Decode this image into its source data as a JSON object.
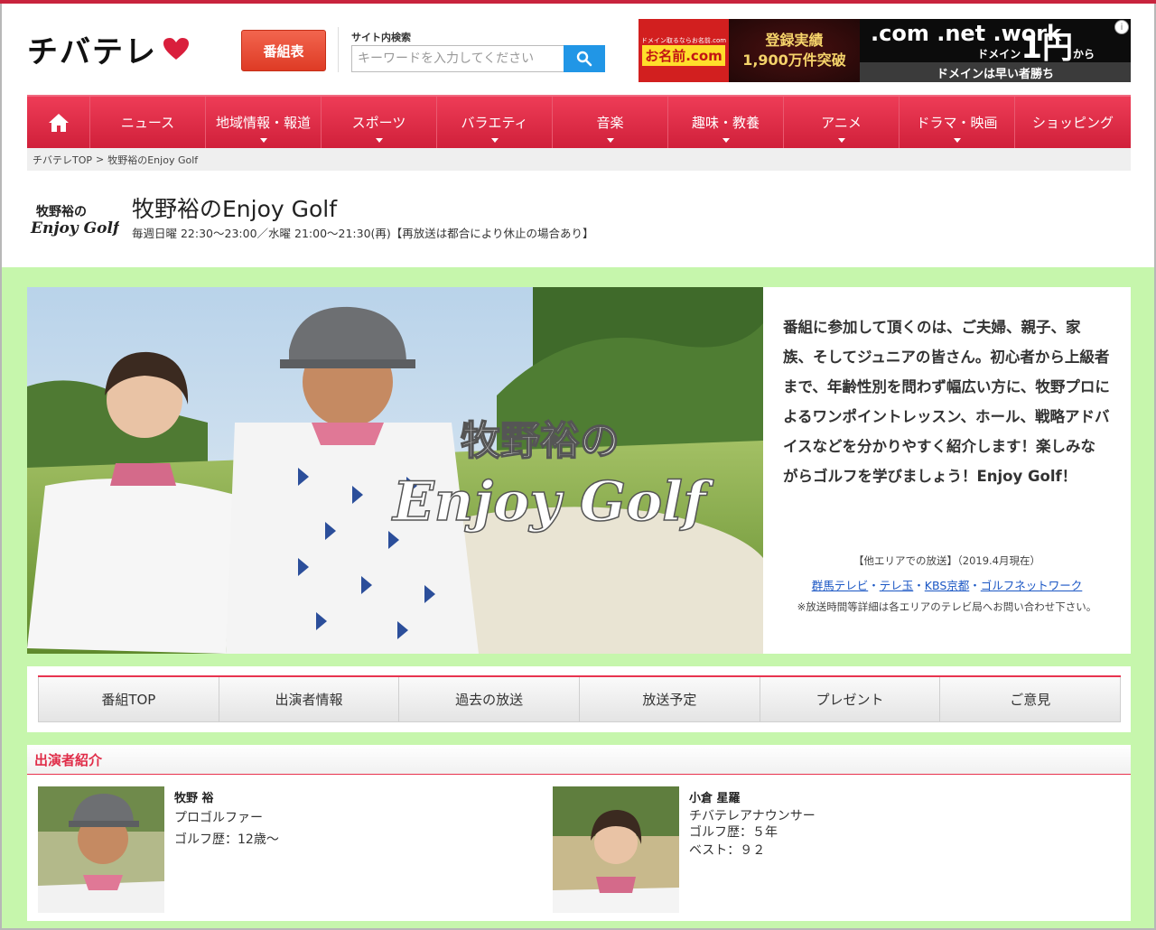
{
  "header": {
    "logo_text": "チバテレ",
    "program_button": "番組表",
    "search_label": "サイト内検索",
    "search_placeholder": "キーワードを入力してください"
  },
  "ad": {
    "brand": "お名前.com",
    "badge": "ドメイン取るならお名前.com",
    "achievement_1": "登録実績",
    "achievement_2": "1,900万件突破",
    "domains": ".com .net .work",
    "price_label": "ドメイン",
    "price": "1円",
    "price_suffix": "から",
    "bar": "ドメインは早い者勝ち",
    "info": "i"
  },
  "nav": {
    "items": [
      {
        "label": "ニュース",
        "dropdown": false
      },
      {
        "label": "地域情報・報道",
        "dropdown": true
      },
      {
        "label": "スポーツ",
        "dropdown": true
      },
      {
        "label": "バラエティ",
        "dropdown": true
      },
      {
        "label": "音楽",
        "dropdown": true
      },
      {
        "label": "趣味・教養",
        "dropdown": true
      },
      {
        "label": "アニメ",
        "dropdown": true
      },
      {
        "label": "ドラマ・映画",
        "dropdown": true
      },
      {
        "label": "ショッピング",
        "dropdown": false
      }
    ]
  },
  "breadcrumb": {
    "home": "チバテレTOP",
    "separator": ">",
    "current": "牧野裕のEnjoy Golf"
  },
  "program": {
    "logo_line1": "牧野裕の",
    "logo_line2": "Enjoy Golf",
    "title": "牧野裕のEnjoy Golf",
    "schedule": "毎週日曜 22:30～23:00／水曜 21:00～21:30(再)【再放送は都合により休止の場合あり】"
  },
  "hero": {
    "title_line1": "牧野裕の",
    "title_line2": "Enjoy Golf",
    "description": "番組に参加して頂くのは、ご夫婦、親子、家族、そしてジュニアの皆さん。初心者から上級者まで、年齢性別を問わず幅広い方に、牧野プロによるワンポイントレッスン、ホール、戦略アドバイスなどを分かりやすく紹介します！楽しみながらゴルフを学びましょう！Enjoy Golf！",
    "other_area": "【他エリアでの放送】（2019.4月現在）",
    "links": [
      "群馬テレビ",
      "テレ玉",
      "KBS京都",
      "ゴルフネットワーク"
    ],
    "link_sep": "・",
    "note": "※放送時間等詳細は各エリアのテレビ局へお問い合わせ下さい。"
  },
  "tabs": [
    "番組TOP",
    "出演者情報",
    "過去の放送",
    "放送予定",
    "プレゼント",
    "ご意見"
  ],
  "cast": {
    "heading": "出演者紹介",
    "members": [
      {
        "name": "牧野 裕",
        "lines": [
          "プロゴルファー",
          "ゴルフ歴：12歳～"
        ]
      },
      {
        "name": "小倉 星羅",
        "lines": [
          "チバテレアナウンサー",
          "ゴルフ歴：５年",
          "ベスト：９２"
        ]
      }
    ]
  },
  "colors": {
    "brand_red": "#d0203a",
    "program_button": "#e0402a",
    "search_button": "#2196e6",
    "green_bg": "#c6f6ac",
    "link_blue": "#1a56c4"
  }
}
